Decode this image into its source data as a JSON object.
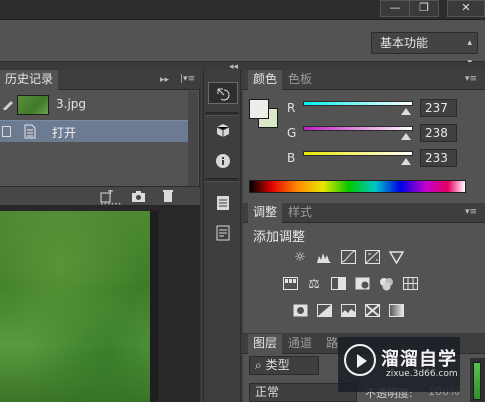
{
  "window": {
    "minimize_glyph": "—",
    "restore_glyph": "❐",
    "close_glyph": "✕"
  },
  "options_bar": {
    "workspace": "基本功能"
  },
  "history_panel": {
    "tab_label": "历史记录",
    "snapshot_name": "3.jpg",
    "steps": [
      {
        "label": "打开"
      }
    ]
  },
  "color_panel": {
    "tabs": [
      "颜色",
      "色板"
    ],
    "channels": [
      {
        "name": "R",
        "value": "237"
      },
      {
        "name": "G",
        "value": "238"
      },
      {
        "name": "B",
        "value": "233"
      }
    ],
    "colors": {
      "foreground": "#edeee9",
      "background": "#d8e8c8"
    }
  },
  "adjustments_panel": {
    "tabs": [
      "调整",
      "样式"
    ],
    "heading": "添加调整"
  },
  "layers_panel": {
    "tabs": [
      "图层",
      "通道",
      "路"
    ],
    "filter_kind": "类型",
    "blend_mode": "正常",
    "opacity_label": "不透明度:",
    "opacity_value": "100%"
  },
  "watermark": {
    "title": "溜溜自学",
    "subtitle": "zixue.3d66.com"
  }
}
